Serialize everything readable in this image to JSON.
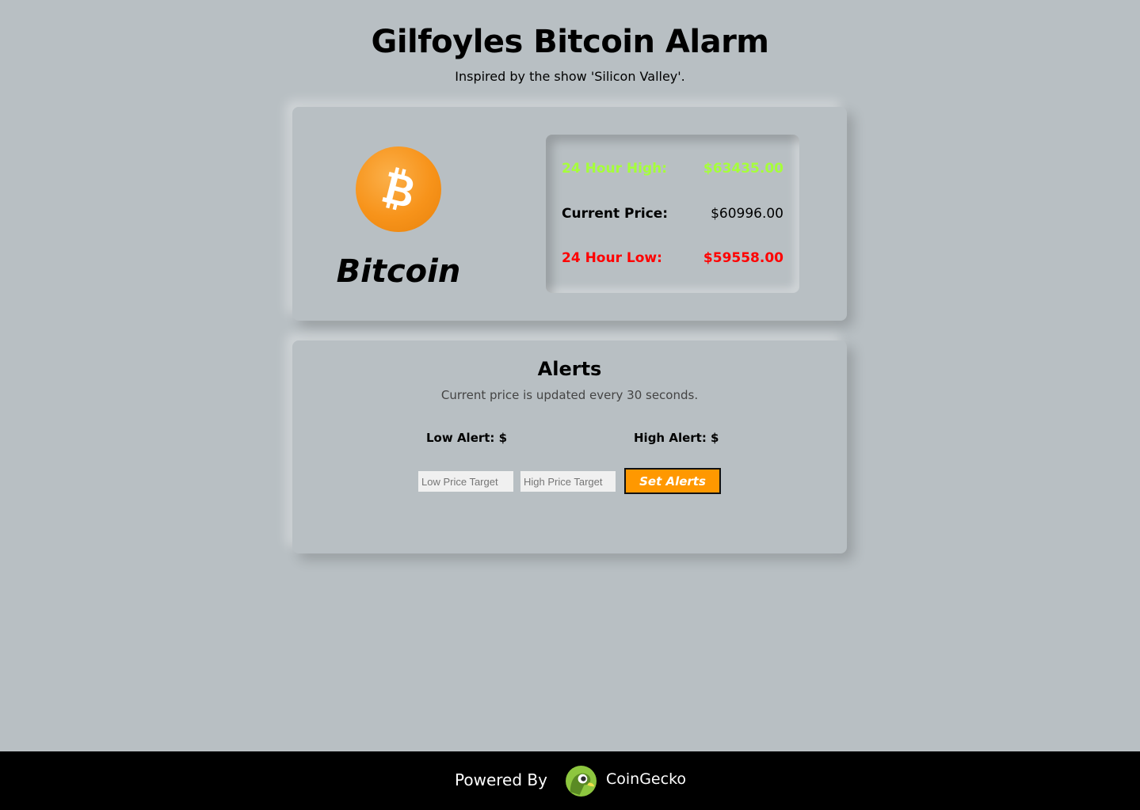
{
  "header": {
    "title": "Gilfoyles Bitcoin Alarm",
    "subtitle": "Inspired by the show 'Silicon Valley'."
  },
  "coin": {
    "name": "Bitcoin",
    "icon": "bitcoin-logo-icon",
    "brand_color": "#f7931a"
  },
  "prices": {
    "high_label": "24 Hour High:",
    "high_value": "$63435.00",
    "current_label": "Current Price:",
    "current_value": "$60996.00",
    "low_label": "24 Hour Low:",
    "low_value": "$59558.00",
    "high_color": "#a6ff3a",
    "low_color": "#ff0000"
  },
  "alerts": {
    "heading": "Alerts",
    "subtext": "Current price is updated every 30 seconds.",
    "low_label": "Low Alert: $",
    "high_label": "High Alert: $",
    "low_placeholder": "Low Price Target",
    "high_placeholder": "High Price Target",
    "button_label": "Set Alerts",
    "button_color": "#ff9800"
  },
  "footer": {
    "powered_by": "Powered By",
    "brand": "CoinGecko",
    "brand_icon": "coingecko-logo-icon"
  }
}
